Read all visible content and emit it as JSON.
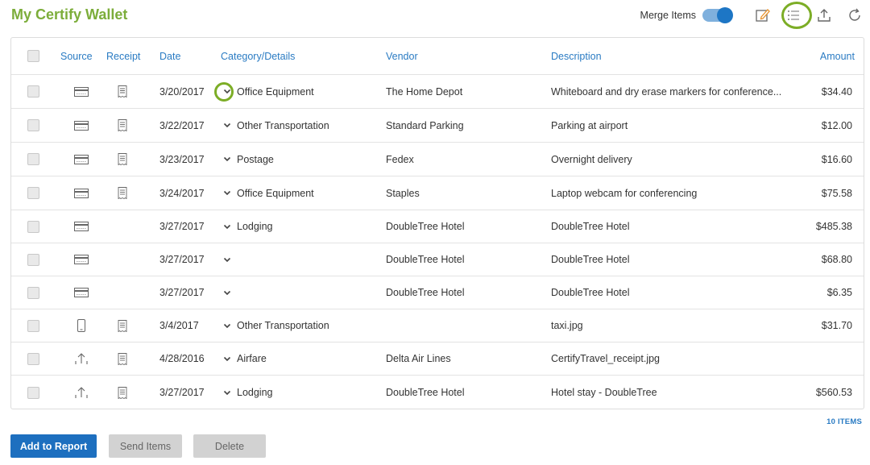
{
  "page": {
    "title": "My Certify Wallet"
  },
  "toolbar": {
    "merge_label": "Merge Items",
    "merge_on": true,
    "icons": [
      "edit-icon",
      "list-view-icon",
      "export-icon",
      "refresh-icon"
    ]
  },
  "table": {
    "headers": {
      "source": "Source",
      "receipt": "Receipt",
      "date": "Date",
      "category": "Category/Details",
      "vendor": "Vendor",
      "description": "Description",
      "amount": "Amount"
    },
    "rows": [
      {
        "source": "card",
        "receipt": true,
        "date": "3/20/2017",
        "category": "Office Equipment",
        "vendor": "The Home Depot",
        "description": "Whiteboard and dry erase markers for conference...",
        "amount": "$34.40"
      },
      {
        "source": "card",
        "receipt": true,
        "date": "3/22/2017",
        "category": "Other Transportation",
        "vendor": "Standard Parking",
        "description": "Parking at airport",
        "amount": "$12.00"
      },
      {
        "source": "card",
        "receipt": true,
        "date": "3/23/2017",
        "category": "Postage",
        "vendor": "Fedex",
        "description": "Overnight delivery",
        "amount": "$16.60"
      },
      {
        "source": "card",
        "receipt": true,
        "date": "3/24/2017",
        "category": "Office Equipment",
        "vendor": "Staples",
        "description": "Laptop webcam for conferencing",
        "amount": "$75.58"
      },
      {
        "source": "card",
        "receipt": false,
        "date": "3/27/2017",
        "category": "Lodging",
        "vendor": "DoubleTree Hotel",
        "description": "DoubleTree Hotel",
        "amount": "$485.38"
      },
      {
        "source": "card",
        "receipt": false,
        "date": "3/27/2017",
        "category": "",
        "vendor": "DoubleTree Hotel",
        "description": "DoubleTree Hotel",
        "amount": "$68.80"
      },
      {
        "source": "card",
        "receipt": false,
        "date": "3/27/2017",
        "category": "",
        "vendor": "DoubleTree Hotel",
        "description": "DoubleTree Hotel",
        "amount": "$6.35"
      },
      {
        "source": "mobile",
        "receipt": true,
        "date": "3/4/2017",
        "category": "Other Transportation",
        "vendor": "",
        "description": "taxi.jpg",
        "amount": "$31.70"
      },
      {
        "source": "upload",
        "receipt": true,
        "date": "4/28/2016",
        "category": "Airfare",
        "vendor": "Delta Air Lines",
        "description": "CertifyTravel_receipt.jpg",
        "amount": ""
      },
      {
        "source": "upload",
        "receipt": true,
        "date": "3/27/2017",
        "category": "Lodging",
        "vendor": "DoubleTree Hotel",
        "description": "Hotel stay - DoubleTree",
        "amount": "$560.53"
      }
    ]
  },
  "footer": {
    "items_count": "10 ITEMS",
    "add_label": "Add to Report",
    "send_label": "Send Items",
    "delete_label": "Delete"
  },
  "colors": {
    "brand_green": "#7cad3a",
    "link_blue": "#2a7bc3",
    "primary_button": "#1d6fbf",
    "highlight_ring": "#7cad26"
  }
}
